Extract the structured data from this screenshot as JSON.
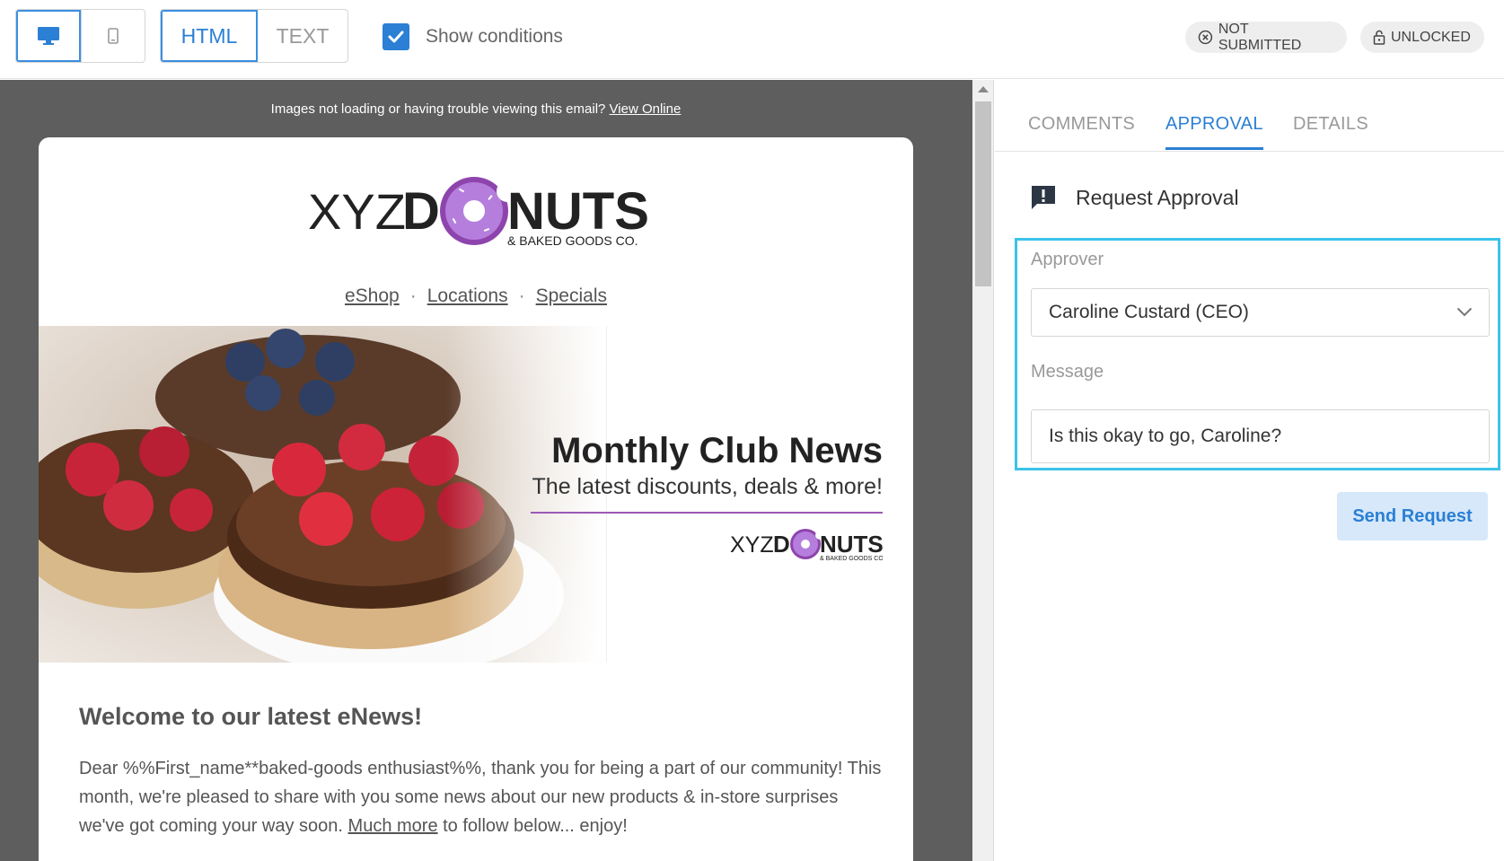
{
  "toolbar": {
    "device_options": [
      "desktop",
      "mobile"
    ],
    "format_html_label": "HTML",
    "format_text_label": "TEXT",
    "show_conditions_label": "Show conditions",
    "show_conditions_checked": true,
    "status_submitted": "NOT SUBMITTED",
    "status_lock": "UNLOCKED"
  },
  "preview": {
    "notice_text": "Images not loading or having trouble viewing this email? ",
    "notice_link": "View Online",
    "logo_text_xyz": "XYZ",
    "logo_text_donuts_d": "D",
    "logo_text_donuts_rest": "NUTS",
    "logo_tagline": "& BAKED GOODS CO.",
    "nav": [
      "eShop",
      "Locations",
      "Specials"
    ],
    "hero_title": "Monthly Club News",
    "hero_subtitle": "The latest discounts, deals & more!",
    "welcome_heading": "Welcome to our latest eNews!",
    "body_part1": "Dear %%First_name**baked-goods enthusiast%%, thank you for being a part of our community! This month, we're pleased to share with you some news about our new products & in-store surprises we've got coming your way soon. ",
    "body_link": "Much more",
    "body_part2": " to follow below... enjoy!"
  },
  "panel": {
    "tabs": [
      "COMMENTS",
      "APPROVAL",
      "DETAILS"
    ],
    "active_tab": "APPROVAL",
    "section_title": "Request Approval",
    "approver_label": "Approver",
    "approver_value": "Caroline Custard (CEO)",
    "message_label": "Message",
    "message_value": "Is this okay to go, Caroline?",
    "send_button": "Send Request"
  },
  "colors": {
    "accent": "#2b7fd4",
    "focus_border": "#3bc3ea",
    "donut_purple": "#8e44ad",
    "preview_bg": "#5e5e5e"
  }
}
